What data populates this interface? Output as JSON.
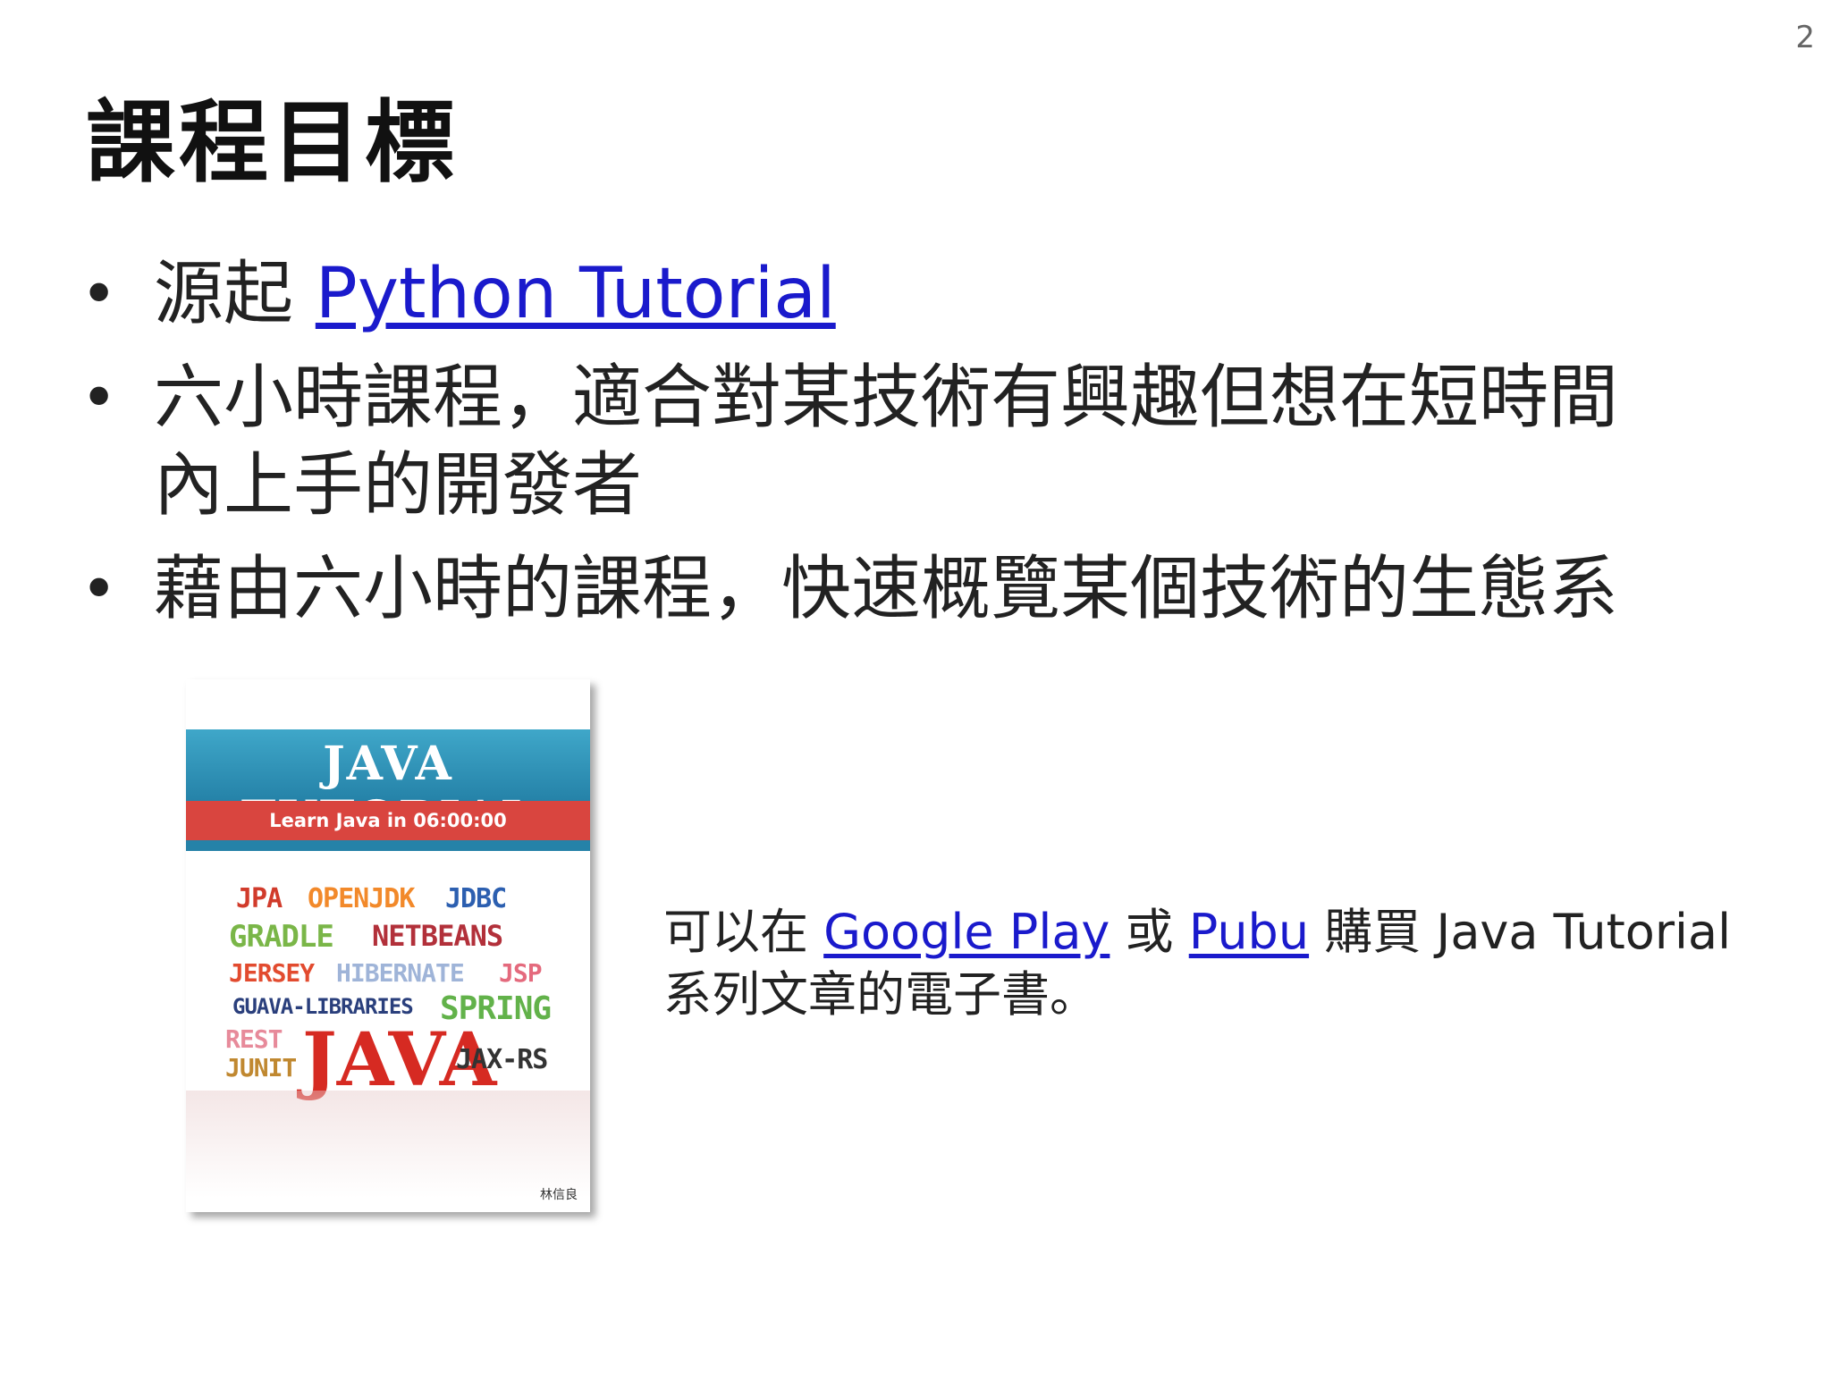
{
  "slide": {
    "page_number": "2",
    "title": "課程目標",
    "bullets": [
      {
        "prefix": "源起 ",
        "link": "Python Tutorial"
      },
      {
        "text": "六小時課程，適合對某技術有興趣但想在短時間內上手的開發者"
      },
      {
        "text": "藉由六小時的課程，快速概覽某個技術的生態系"
      }
    ],
    "cover": {
      "title": "JAVA TUTORIAL",
      "subtitle": "Learn Java in 06:00:00",
      "words": [
        "JPA",
        "OPENJDK",
        "JDBC",
        "GRADLE",
        "NETBEANS",
        "JERSEY",
        "HIBERNATE",
        "JSP",
        "GUAVA-LIBRARIES",
        "SPRING",
        "REST",
        "JAVA",
        "JUNIT",
        "JAX-RS"
      ],
      "author": "林信良"
    },
    "caption": {
      "part1": "可以在 ",
      "link1": "Google Play",
      "part2": " 或 ",
      "link2": "Pubu",
      "part3": " 購買 Java Tutorial 系列文章的電子書。"
    },
    "colors": {
      "link": "#1a1acc",
      "cover_header": "#2582a8",
      "cover_band": "#d9453f"
    }
  }
}
